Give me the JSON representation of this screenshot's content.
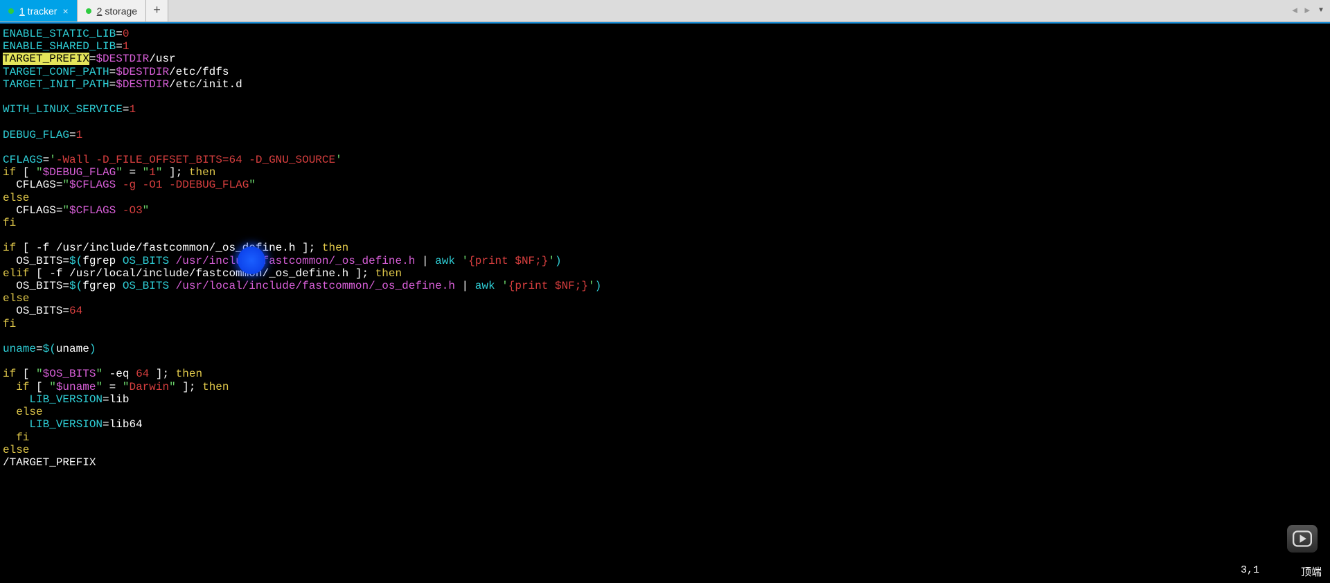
{
  "tabs": {
    "active": {
      "label": "1 tracker",
      "underline": "1"
    },
    "inactive": {
      "label": "2 storage",
      "underline": "2"
    }
  },
  "code": {
    "l1": {
      "var": "ENABLE_STATIC_LIB",
      "val": "0"
    },
    "l2": {
      "var": "ENABLE_SHARED_LIB",
      "val": "1"
    },
    "l3": {
      "var": "TARGET_PREFIX",
      "dest": "$DESTDIR",
      "path": "/usr"
    },
    "l4": {
      "var": "TARGET_CONF_PATH",
      "dest": "$DESTDIR",
      "path": "/etc/fdfs"
    },
    "l5": {
      "var": "TARGET_INIT_PATH",
      "dest": "$DESTDIR",
      "path": "/etc/init.d"
    },
    "l6": {
      "var": "WITH_LINUX_SERVICE",
      "val": "1"
    },
    "l7": {
      "var": "DEBUG_FLAG",
      "val": "1"
    },
    "l8": {
      "var": "CFLAGS",
      "q1": "'",
      "flags": "-Wall -D_FILE_OFFSET_BITS=64 -D_GNU_SOURCE",
      "q2": "'"
    },
    "l9": {
      "if": "if",
      "ob": " [ ",
      "q1": "\"",
      "dv": "$DEBUG_FLAG",
      "q2": "\"",
      "mid": " = ",
      "q3": "\"",
      "one": "1",
      "q4": "\"",
      "cb": " ]; ",
      "then": "then"
    },
    "l10": {
      "pre": "  CFLAGS=",
      "q1": "\"",
      "cf": "$CFLAGS",
      "sp": " ",
      "go": "-g -O1 -DDEBUG_FLAG",
      "q2": "\""
    },
    "l11": {
      "else": "else"
    },
    "l12": {
      "pre": "  CFLAGS=",
      "q1": "\"",
      "cf": "$CFLAGS",
      "sp": " ",
      "o3": "-O3",
      "q2": "\""
    },
    "l13": {
      "fi": "fi"
    },
    "l14": {
      "if": "if",
      "cond": " [ -f /usr/include/fastcommon/_os_define.h ]; ",
      "then": "then"
    },
    "l15": {
      "pre": "  OS_BITS=",
      "dop": "$(",
      "fg": "fgrep ",
      "ob": "OS_BITS",
      "sp": " ",
      "path": "/usr/include/fastcommon/_os_define.h",
      "pipe": " | ",
      "awk": "awk ",
      "q1": "'",
      "br": "{print $NF;}",
      "q2": "'",
      "cp": ")"
    },
    "l16": {
      "elif": "elif",
      "cond": " [ -f /usr/local/include/fastcommon/_os_define.h ]; ",
      "then": "then"
    },
    "l17": {
      "pre": "  OS_BITS=",
      "dop": "$(",
      "fg": "fgrep ",
      "ob": "OS_BITS",
      "sp": " ",
      "path": "/usr/local/include/fastcommon/_os_define.h",
      "pipe": " | ",
      "awk": "awk ",
      "q1": "'",
      "br": "{print $NF;}",
      "q2": "'",
      "cp": ")"
    },
    "l18": {
      "else": "else"
    },
    "l19": {
      "pre": "  OS_BITS=",
      "val": "64"
    },
    "l20": {
      "fi": "fi"
    },
    "l21": {
      "var": "uname",
      "dop": "$(",
      "cmd": "uname",
      "cp": ")"
    },
    "l22": {
      "if": "if",
      "ob": " [ ",
      "q1": "\"",
      "os": "$OS_BITS",
      "q2": "\"",
      "eq": " -eq ",
      "n64": "64",
      "cb": " ]; ",
      "then": "then"
    },
    "l23": {
      "pre": "  ",
      "if": "if",
      "ob": " [ ",
      "q1": "\"",
      "un": "$uname",
      "q2": "\"",
      "mid": " = ",
      "q3": "\"",
      "dw": "Darwin",
      "q4": "\"",
      "cb": " ]; ",
      "then": "then"
    },
    "l24": {
      "pre": "    ",
      "var": "LIB_VERSION",
      "val": "=lib"
    },
    "l25": {
      "pre": "  ",
      "else": "else"
    },
    "l26": {
      "pre": "    ",
      "var": "LIB_VERSION",
      "val": "=lib64"
    },
    "l27": {
      "pre": "  ",
      "fi": "fi"
    },
    "l28": {
      "else": "else"
    },
    "search": "/TARGET_PREFIX"
  },
  "status": {
    "pos": "3,1",
    "label": "顶端"
  }
}
